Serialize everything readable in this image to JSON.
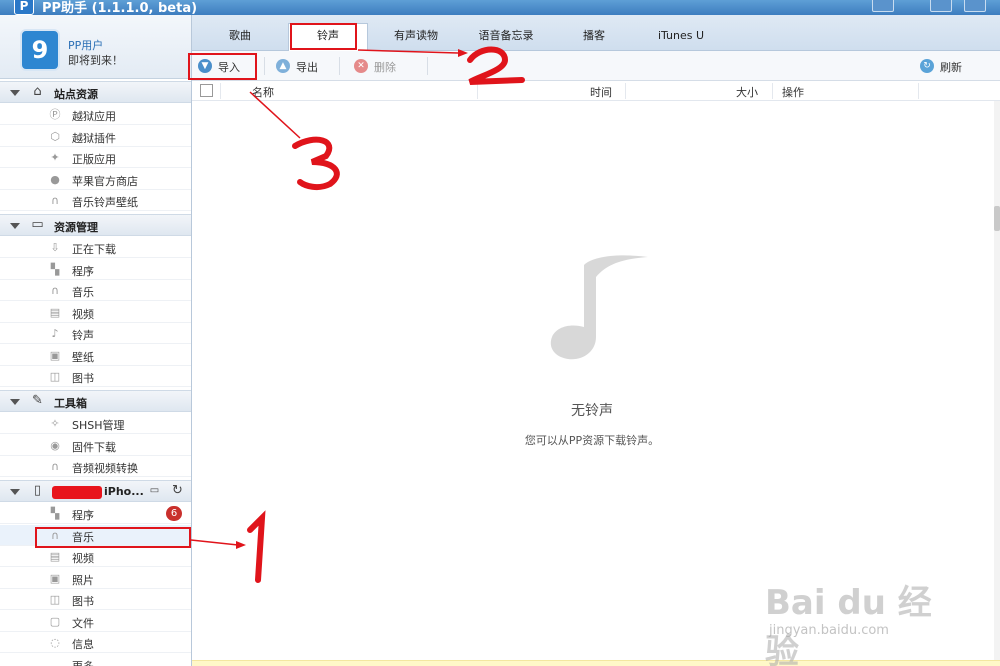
{
  "window": {
    "title": "PP助手 (1.1.1.0, beta)",
    "logo": "P"
  },
  "user": {
    "name": "PP用户",
    "subtitle": "即将到来！",
    "avatar_glyph": "9"
  },
  "sidebar": {
    "groups": [
      {
        "label": "站点资源",
        "icon": "home-icon",
        "items": [
          {
            "label": "越狱应用",
            "icon": "pp-icon"
          },
          {
            "label": "越狱插件",
            "icon": "cube-icon"
          },
          {
            "label": "正版应用",
            "icon": "store-icon"
          },
          {
            "label": "苹果官方商店",
            "icon": "apple-icon"
          },
          {
            "label": "音乐铃声壁纸",
            "icon": "headphones-icon"
          }
        ]
      },
      {
        "label": "资源管理",
        "icon": "monitor-icon",
        "items": [
          {
            "label": "正在下载",
            "icon": "download-icon"
          },
          {
            "label": "程序",
            "icon": "apps-icon"
          },
          {
            "label": "音乐",
            "icon": "headphones-icon"
          },
          {
            "label": "视频",
            "icon": "film-icon"
          },
          {
            "label": "铃声",
            "icon": "music-note-icon"
          },
          {
            "label": "壁纸",
            "icon": "image-icon"
          },
          {
            "label": "图书",
            "icon": "book-icon"
          }
        ]
      },
      {
        "label": "工具箱",
        "icon": "tools-icon",
        "items": [
          {
            "label": "SHSH管理",
            "icon": "shsh-icon"
          },
          {
            "label": "固件下载",
            "icon": "firmware-icon"
          },
          {
            "label": "音频视频转换",
            "icon": "convert-icon"
          }
        ]
      },
      {
        "label": "iPho...",
        "icon": "phone-icon",
        "items": [
          {
            "label": "程序",
            "icon": "apps-icon",
            "badge": "6"
          },
          {
            "label": "音乐",
            "icon": "headphones-icon"
          },
          {
            "label": "视频",
            "icon": "film-icon"
          },
          {
            "label": "照片",
            "icon": "photo-icon"
          },
          {
            "label": "图书",
            "icon": "book-icon"
          },
          {
            "label": "文件",
            "icon": "file-icon"
          },
          {
            "label": "信息",
            "icon": "message-icon"
          },
          {
            "label": "更多",
            "icon": "more-icon"
          }
        ]
      }
    ]
  },
  "tabs": [
    "歌曲",
    "铃声",
    "有声读物",
    "语音备忘录",
    "播客",
    "iTunes U"
  ],
  "active_tab": "铃声",
  "toolbar": {
    "import": "导入",
    "export": "导出",
    "delete": "删除",
    "refresh": "刷新"
  },
  "table": {
    "columns": [
      "名称",
      "时间",
      "大小",
      "操作"
    ]
  },
  "empty": {
    "title": "无铃声",
    "subtitle": "您可以从PP资源下载铃声。"
  },
  "annotations": {
    "one": "1",
    "two": "2",
    "three": "3"
  },
  "watermark": {
    "logo": "Bai du 经验",
    "site": "jingyan.baidu.com"
  },
  "colors": {
    "annotation": "#e0141b",
    "accent": "#2a78c8",
    "badge": "#c9302c"
  }
}
